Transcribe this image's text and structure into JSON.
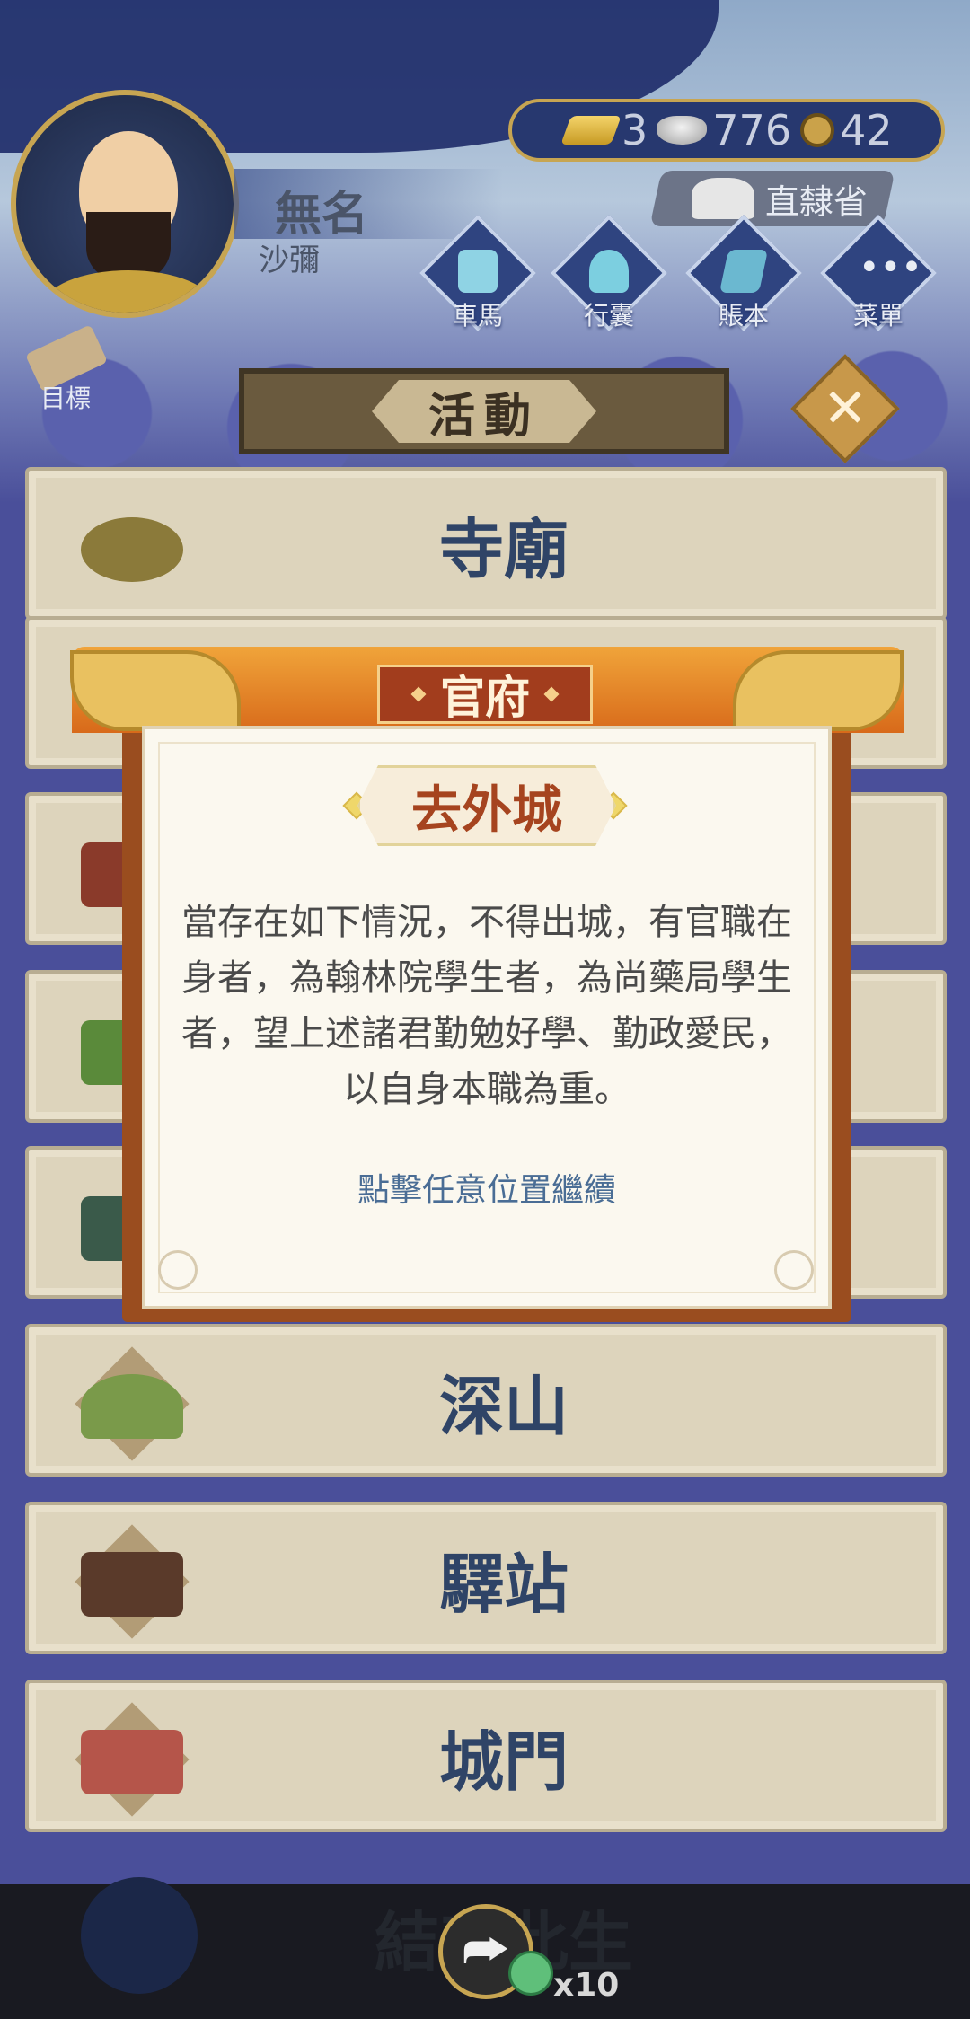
{
  "player": {
    "name": "無名",
    "rank": "沙彌"
  },
  "resources": {
    "gold": "3",
    "silver": "776",
    "copper": "42"
  },
  "location": "直隸省",
  "menu": [
    {
      "label": "車馬",
      "icon": "carriage-icon"
    },
    {
      "label": "行囊",
      "icon": "bag-icon"
    },
    {
      "label": "賬本",
      "icon": "ledger-icon"
    },
    {
      "label": "菜單",
      "icon": "more-icon"
    }
  ],
  "goal_label": "目標",
  "activity_title": "活動",
  "list": [
    "寺廟",
    "",
    "",
    "",
    "",
    "深山",
    "驛站",
    "城門"
  ],
  "last_item": "結束此生",
  "modal": {
    "header": "官府",
    "subtitle": "去外城",
    "body": "當存在如下情況，不得出城，有官職在身者，為翰林院學生者，為尚藥局學生者，望上述諸君勤勉好學、勤政愛民，以自身本職為重。",
    "hint": "點擊任意位置繼續"
  },
  "share_count": "x10",
  "colors": {
    "header_orange": "#e07a22",
    "accent_gold": "#c7a552",
    "title_red": "#a6441f",
    "list_text": "#2f4467"
  }
}
